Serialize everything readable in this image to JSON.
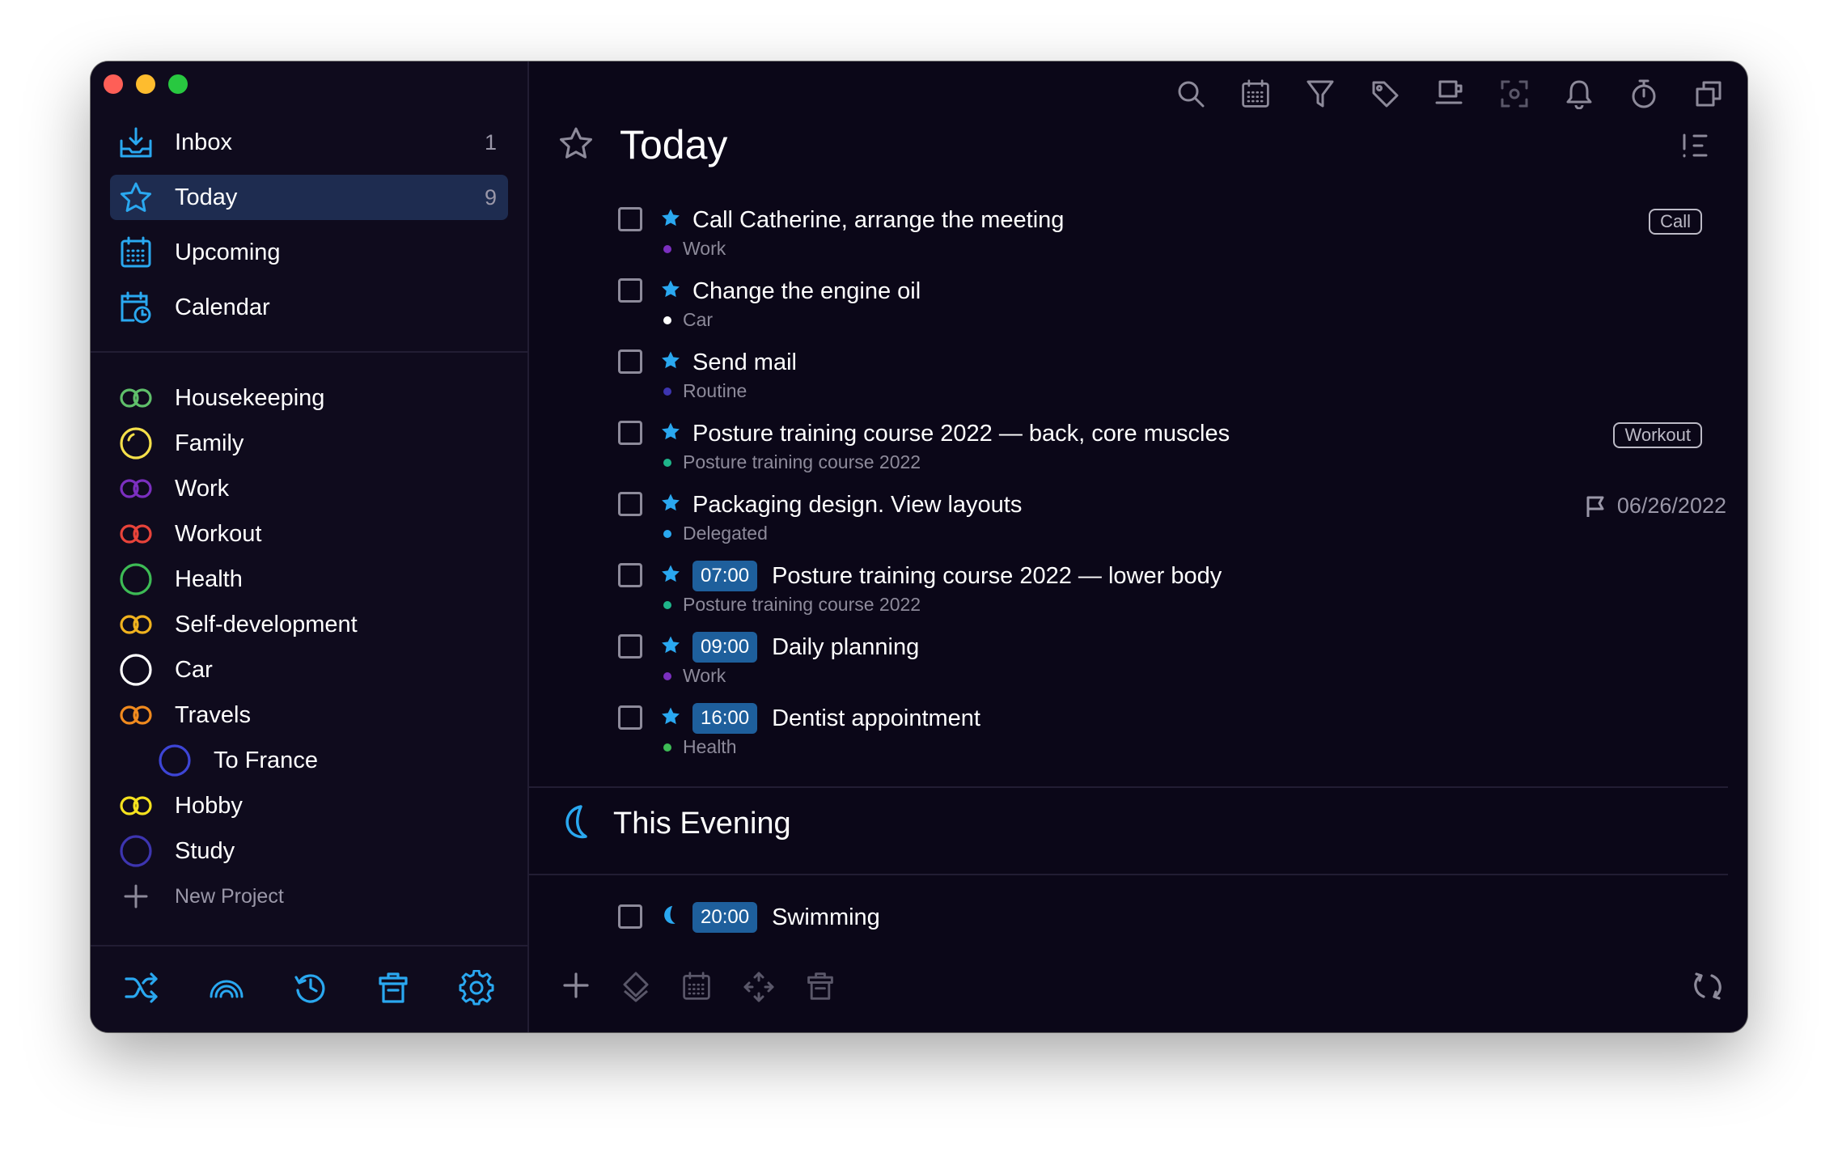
{
  "sidebar": {
    "nav": [
      {
        "label": "Inbox",
        "count": "1",
        "icon": "inbox-icon"
      },
      {
        "label": "Today",
        "count": "9",
        "icon": "star-icon"
      },
      {
        "label": "Upcoming",
        "count": "",
        "icon": "calendar-grid-icon"
      },
      {
        "label": "Calendar",
        "count": "",
        "icon": "calendar-clock-icon"
      }
    ],
    "projects": [
      {
        "label": "Housekeeping",
        "color": "#5fbf6a",
        "icon": "double-ring-icon"
      },
      {
        "label": "Family",
        "color": "#f5e04a",
        "icon": "ring-icon"
      },
      {
        "label": "Work",
        "color": "#7b2fbf",
        "icon": "double-ring-icon"
      },
      {
        "label": "Workout",
        "color": "#e8433a",
        "icon": "double-ring-icon"
      },
      {
        "label": "Health",
        "color": "#3dbb55",
        "icon": "ring-icon"
      },
      {
        "label": "Self-development",
        "color": "#f0b21e",
        "icon": "double-ring-icon"
      },
      {
        "label": "Car",
        "color": "#ffffff",
        "icon": "ring-icon"
      },
      {
        "label": "Travels",
        "color": "#f08a1e",
        "icon": "double-ring-icon"
      },
      {
        "label": "To France",
        "color": "#3d45d6",
        "icon": "ring-icon"
      },
      {
        "label": "Hobby",
        "color": "#f5e21e",
        "icon": "double-ring-icon"
      },
      {
        "label": "Study",
        "color": "#3d35b0",
        "icon": "ring-icon"
      }
    ],
    "new_project": "New Project",
    "accent": "#2aa8f0"
  },
  "main": {
    "title": "Today",
    "tasks": [
      {
        "name": "Call Catherine, arrange the meeting",
        "time": "",
        "project": "Work",
        "dot": "#7b2fbf",
        "tag": "Call",
        "due": ""
      },
      {
        "name": "Change the engine oil",
        "time": "",
        "project": "Car",
        "dot": "#ffffff",
        "tag": "",
        "due": ""
      },
      {
        "name": "Send mail",
        "time": "",
        "project": "Routine",
        "dot": "#3d35b0",
        "tag": "",
        "due": ""
      },
      {
        "name": "Posture training course 2022 — back, core muscles",
        "time": "",
        "project": "Posture training course 2022",
        "dot": "#1fb58a",
        "tag": "Workout",
        "due": ""
      },
      {
        "name": "Packaging design. View layouts",
        "time": "",
        "project": "Delegated",
        "dot": "#2aa8f0",
        "tag": "",
        "due": "06/26/2022"
      },
      {
        "name": "Posture training course 2022 — lower body",
        "time": "07:00",
        "project": "Posture training course 2022",
        "dot": "#1fb58a",
        "tag": "",
        "due": ""
      },
      {
        "name": "Daily planning",
        "time": "09:00",
        "project": "Work",
        "dot": "#7b2fbf",
        "tag": "",
        "due": ""
      },
      {
        "name": "Dentist appointment",
        "time": "16:00",
        "project": "Health",
        "dot": "#3dbb55",
        "tag": "",
        "due": ""
      }
    ],
    "evening": {
      "title": "This Evening",
      "tasks": [
        {
          "name": "Swimming",
          "time": "20:00"
        }
      ]
    }
  }
}
